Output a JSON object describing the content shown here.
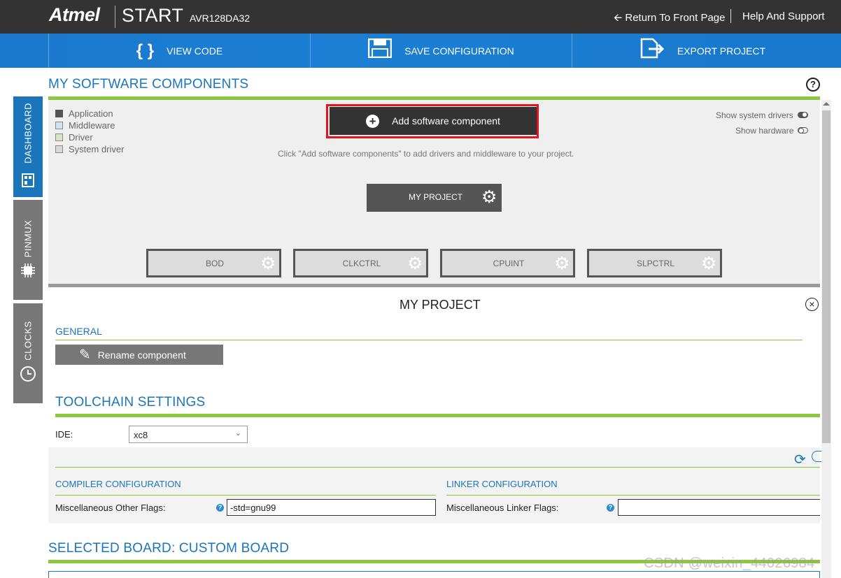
{
  "header": {
    "brand": "Atmel",
    "product": "START",
    "device": "AVR128DA32",
    "return_link": "Return To Front Page",
    "help_link": "Help And Support"
  },
  "toolbar": {
    "view_code": "VIEW CODE",
    "save_configuration": "SAVE CONFIGURATION",
    "export_project": "EXPORT PROJECT"
  },
  "side_tabs": [
    "DASHBOARD",
    "PINMUX",
    "CLOCKS"
  ],
  "components": {
    "title": "MY SOFTWARE COMPONENTS",
    "legend": [
      {
        "label": "Application",
        "color": "#555555"
      },
      {
        "label": "Middleware",
        "color": "#cfe3f3"
      },
      {
        "label": "Driver",
        "color": "#d7e6c0"
      },
      {
        "label": "System driver",
        "color": "#d9d9d9"
      }
    ],
    "add_button": "Add software component",
    "hint": "Click \"Add software components\" to add drivers and middleware to your project.",
    "show_system_drivers": "Show system drivers",
    "show_hardware": "Show hardware",
    "project_node": "MY PROJECT",
    "drivers": [
      "BOD",
      "CLKCTRL",
      "CPUINT",
      "SLPCTRL"
    ]
  },
  "project_panel": {
    "title": "MY PROJECT",
    "general_title": "GENERAL",
    "rename_button": "Rename component",
    "toolchain_title": "TOOLCHAIN SETTINGS",
    "ide_label": "IDE:",
    "ide_value": "xc8",
    "compiler_title": "COMPILER CONFIGURATION",
    "compiler_flags_label": "Miscellaneous Other Flags:",
    "compiler_flags_value": "-std=gnu99",
    "linker_title": "LINKER CONFIGURATION",
    "linker_flags_label": "Miscellaneous Linker Flags:",
    "linker_flags_value": ""
  },
  "board": {
    "title": "SELECTED BOARD: CUSTOM BOARD"
  },
  "watermark": "CSDN @weixin_44026984",
  "colors": {
    "accent_blue": "#1a75bb",
    "accent_green": "#8dc63f",
    "highlight_red": "#e2141c"
  }
}
